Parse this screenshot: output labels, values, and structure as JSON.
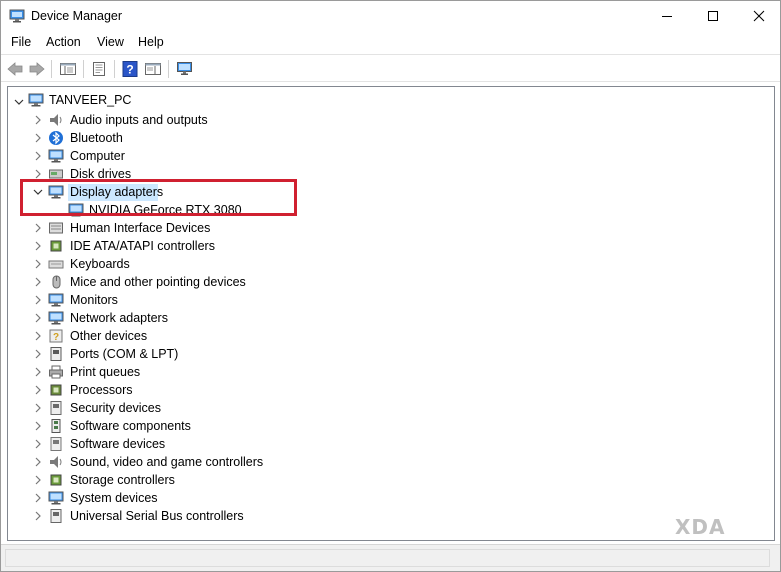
{
  "window": {
    "title": "Device Manager",
    "accent": "#0078d7",
    "highlight_color": "#d02030"
  },
  "menu": {
    "file": "File",
    "action": "Action",
    "view": "View",
    "help": "Help"
  },
  "toolbar": {
    "icons": [
      "back-arrow-icon",
      "forward-arrow-icon",
      "show-hide-tree-icon",
      "properties-icon",
      "help-icon",
      "action-pane-icon",
      "scan-hardware-icon"
    ]
  },
  "tree": {
    "root": "TANVEER_PC",
    "categories": [
      {
        "label": "Audio inputs and outputs",
        "icon": "speaker-icon"
      },
      {
        "label": "Bluetooth",
        "icon": "bluetooth-icon"
      },
      {
        "label": "Computer",
        "icon": "computer-icon"
      },
      {
        "label": "Disk drives",
        "icon": "disk-drive-icon"
      },
      {
        "label": "Display adapters",
        "icon": "display-adapter-icon",
        "expanded": true,
        "children": [
          "NVIDIA GeForce RTX 3080"
        ]
      },
      {
        "label": "Human Interface Devices",
        "icon": "hid-icon"
      },
      {
        "label": "IDE ATA/ATAPI controllers",
        "icon": "ide-controller-icon"
      },
      {
        "label": "Keyboards",
        "icon": "keyboard-icon"
      },
      {
        "label": "Mice and other pointing devices",
        "icon": "mouse-icon"
      },
      {
        "label": "Monitors",
        "icon": "monitor-icon"
      },
      {
        "label": "Network adapters",
        "icon": "network-adapter-icon"
      },
      {
        "label": "Other devices",
        "icon": "other-devices-icon"
      },
      {
        "label": "Ports (COM & LPT)",
        "icon": "port-icon"
      },
      {
        "label": "Print queues",
        "icon": "printer-icon"
      },
      {
        "label": "Processors",
        "icon": "processor-icon"
      },
      {
        "label": "Security devices",
        "icon": "security-device-icon"
      },
      {
        "label": "Software components",
        "icon": "software-component-icon"
      },
      {
        "label": "Software devices",
        "icon": "software-device-icon"
      },
      {
        "label": "Sound, video and game controllers",
        "icon": "sound-controller-icon"
      },
      {
        "label": "Storage controllers",
        "icon": "storage-controller-icon"
      },
      {
        "label": "System devices",
        "icon": "system-device-icon"
      },
      {
        "label": "Universal Serial Bus controllers",
        "icon": "usb-icon"
      }
    ]
  },
  "watermark": "XDA"
}
